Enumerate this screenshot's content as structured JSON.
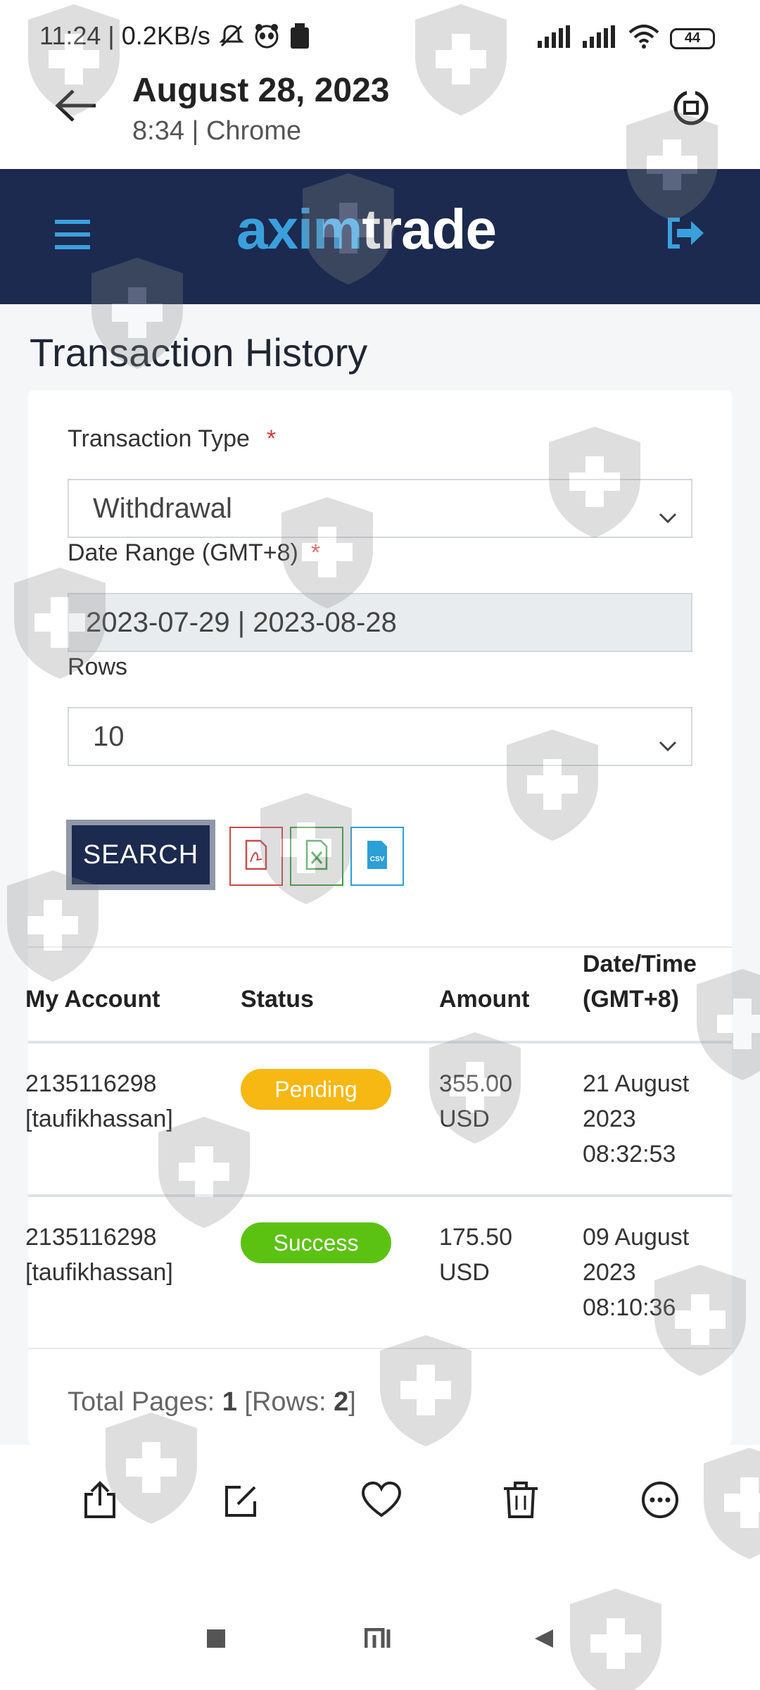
{
  "status_bar": {
    "time": "11:24",
    "net_speed": "0.2KB/s",
    "battery": "44"
  },
  "viewer": {
    "date": "August 28, 2023",
    "subtitle": "8:34 | Chrome"
  },
  "site": {
    "logo_part1": "axim",
    "logo_part2": "trade"
  },
  "page": {
    "title": "Transaction History"
  },
  "form": {
    "transaction_type_label": "Transaction Type",
    "transaction_type_value": "Withdrawal",
    "date_range_label": "Date Range (GMT+8)",
    "date_range_value": "2023-07-29 | 2023-08-28",
    "rows_label": "Rows",
    "rows_value": "10",
    "required_mark": "*",
    "search_label": "SEARCH",
    "export_csv_text": "CSV"
  },
  "table": {
    "headers": {
      "account": "My Account",
      "status": "Status",
      "amount": "Amount",
      "datetime_line1": "Date/Time",
      "datetime_line2": "(GMT+8)"
    },
    "rows": [
      {
        "account_id": "2135116298",
        "account_name": "[taufikhassan]",
        "status": "Pending",
        "amount": "355.00",
        "currency": "USD",
        "date_line1": "21 August",
        "date_line2": "2023",
        "time": "08:32:53"
      },
      {
        "account_id": "2135116298",
        "account_name": "[taufikhassan]",
        "status": "Success",
        "amount": "175.50",
        "currency": "USD",
        "date_line1": "09 August",
        "date_line2": "2023",
        "time": "08:10:36"
      }
    ]
  },
  "footer": {
    "total_pages_label": "Total Pages:",
    "total_pages": "1",
    "rows_label": "[Rows:",
    "rows": "2",
    "rows_close": "]"
  },
  "colors": {
    "navy": "#1b2a4e",
    "brand_blue": "#3aa0dd",
    "pending": "#f7b813",
    "success": "#5cc212",
    "required": "#d63a3a"
  }
}
